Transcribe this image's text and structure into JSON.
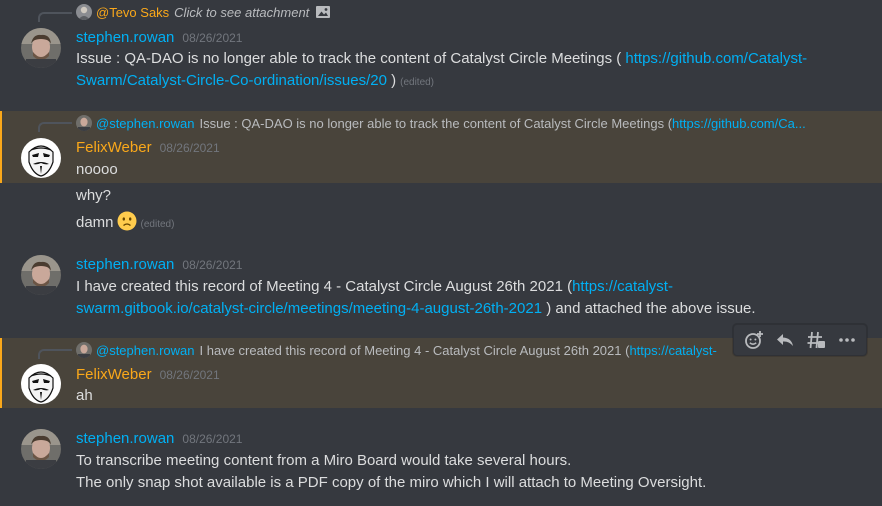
{
  "top_reply": {
    "name": "@Tevo Saks",
    "text": "Click to see attachment",
    "name_color": "#faa81a"
  },
  "messages": [
    {
      "author": "stephen.rowan",
      "author_color": "#00b0f4",
      "timestamp": "08/26/2021",
      "line1_text": "Issue : QA-DAO is no longer able to track the content of Catalyst Circle Meetings ( ",
      "line1_link": "https://github.com/Catalyst-",
      "line2_link": "Swarm/Catalyst-Circle-Co-ordination/issues/20",
      "line2_text": " )",
      "edited": "(edited)"
    },
    {
      "reply_name": "@stephen.rowan",
      "reply_text": "Issue : QA-DAO is no longer able to track the content of Catalyst Circle Meetings ( ",
      "reply_link": "https://github.com/Ca...",
      "author": "FelixWeber",
      "author_color": "#faa81a",
      "timestamp": "08/26/2021",
      "lines": [
        "noooo",
        "why?",
        "damn"
      ],
      "edited": "(edited)"
    },
    {
      "author": "stephen.rowan",
      "author_color": "#00b0f4",
      "timestamp": "08/26/2021",
      "line1_text": "I have created this record of Meeting 4 - Catalyst Circle August 26th 2021 (",
      "line1_link": "https://catalyst-",
      "line2_link": "swarm.gitbook.io/catalyst-circle/meetings/meeting-4-august-26th-2021",
      "line2_text": " ) and attached the above issue."
    },
    {
      "reply_name": "@stephen.rowan",
      "reply_text": "I have created this record of Meeting 4 - Catalyst Circle August 26th 2021 (",
      "reply_link": "https://catalyst-",
      "author": "FelixWeber",
      "author_color": "#faa81a",
      "timestamp": "08/26/2021",
      "lines": [
        "ah"
      ]
    },
    {
      "author": "stephen.rowan",
      "author_color": "#00b0f4",
      "timestamp": "08/26/2021",
      "lines": [
        "To transcribe meeting content from a Miro Board would take several hours.",
        "The only snap shot available is a PDF copy of the miro which I will attach to Meeting Oversight."
      ]
    }
  ],
  "toolbar": {
    "icons": [
      "add-reaction-icon",
      "reply-icon",
      "create-thread-icon",
      "more-icon"
    ]
  }
}
